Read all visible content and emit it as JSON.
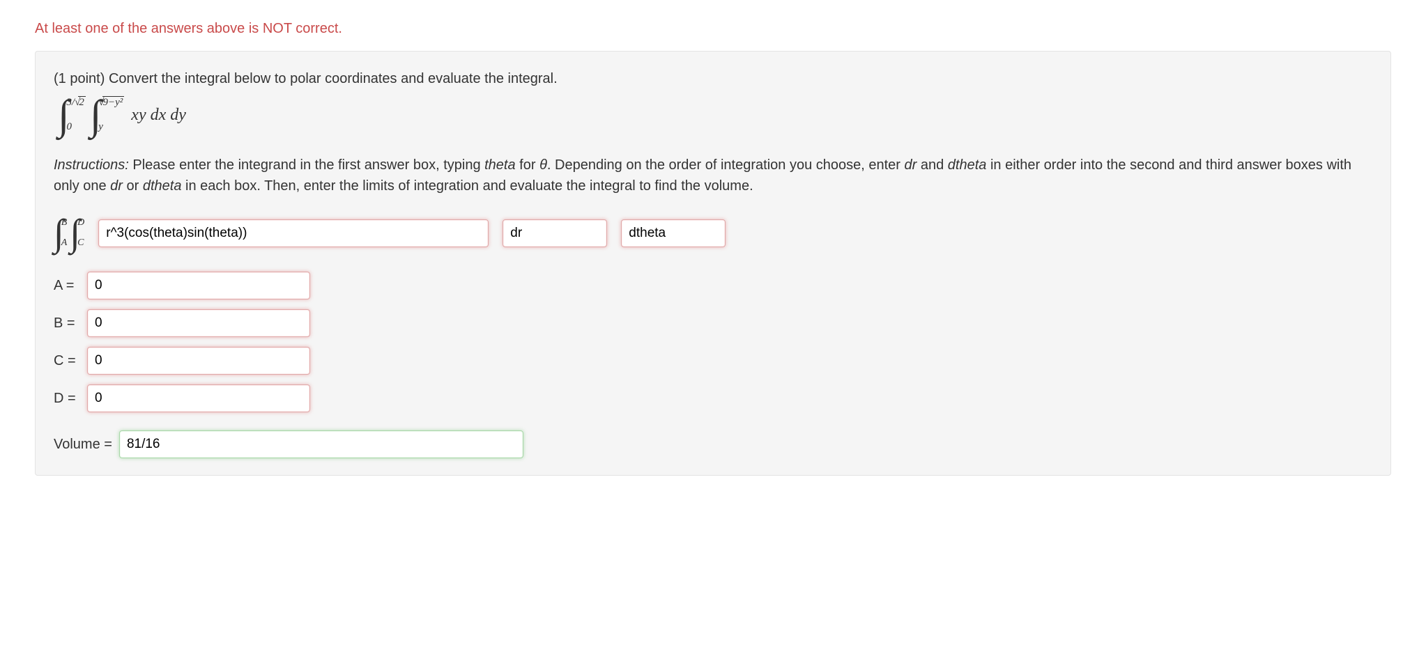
{
  "error_message": "At least one of the answers above is NOT correct.",
  "problem": {
    "points": "(1 point)",
    "prompt": "Convert the integral below to polar coordinates and evaluate the integral.",
    "outer_upper": "3/√2",
    "outer_lower": "0",
    "inner_upper_sqrt_arg": "9−y²",
    "inner_lower": "y",
    "integrand": "xy dx dy"
  },
  "instructions": {
    "label": "Instructions:",
    "text1": " Please enter the integrand in the first answer box, typing ",
    "theta_word": "theta",
    "text2": " for ",
    "theta_sym": "θ",
    "text3": ". Depending on the order of integration you choose, enter ",
    "dr": "dr",
    "text4": " and ",
    "dtheta": "dtheta",
    "text5": " in either order into the second and third answer boxes with only one ",
    "text6": " or ",
    "text7": " in each box. Then, enter the limits of integration and evaluate the integral to find the volume."
  },
  "answer_integral": {
    "outer_upper": "B",
    "outer_lower": "A",
    "inner_upper": "D",
    "inner_lower": "C"
  },
  "inputs": {
    "integrand": "r^3(cos(theta)sin(theta))",
    "d1": "dr",
    "d2": "dtheta",
    "A": "0",
    "B": "0",
    "C": "0",
    "D": "0",
    "volume": "81/16"
  },
  "labels": {
    "A": "A =",
    "B": "B =",
    "C": "C =",
    "D": "D =",
    "volume": "Volume ="
  }
}
